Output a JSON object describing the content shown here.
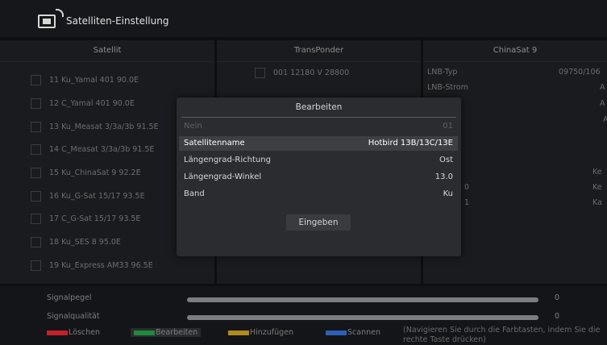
{
  "header": {
    "title": "Satelliten-Einstellung"
  },
  "columns": {
    "satellite": "Satellit",
    "transponder": "TransPonder",
    "info": "ChinaSat 9"
  },
  "satellites": [
    "11  Ku_Yamal 401 90.0E",
    "12  C_Yamal 401 90.0E",
    "13  Ku_Measat 3/3a/3b 91.5E",
    "14  C_Measat 3/3a/3b 91.5E",
    "15  Ku_ChinaSat 9 92.2E",
    "16  Ku_G-Sat 15/17 93.5E",
    "17  C_G-Sat 15/17 93.5E",
    "18  Ku_SES 8 95.0E",
    "19  Ku_Express AM33 96.5E"
  ],
  "transponder": {
    "row": "001   12180  V  28800"
  },
  "info": {
    "lnb_typ_label": "LNB-Typ",
    "lnb_typ_value": "09750/106",
    "lnb_strom_label": "LNB-Strom",
    "lnb_strom_value": "A",
    "partial_values": [
      "A",
      "A",
      "Ke",
      "Ke",
      "Ka",
      "0",
      "1"
    ]
  },
  "dialog": {
    "title": "Bearbeiten",
    "rows": [
      {
        "label": "Nein",
        "value": "01"
      },
      {
        "label": "Satellitenname",
        "value": "Hotbird 13B/13C/13E"
      },
      {
        "label": "Längengrad-Richtung",
        "value": "Ost"
      },
      {
        "label": "Längengrad-Winkel",
        "value": "13.0"
      },
      {
        "label": "Band",
        "value": "Ku"
      }
    ],
    "enter_button": "Eingeben"
  },
  "signal": {
    "level_label": "Signalpegel",
    "level_value": "0",
    "quality_label": "Signalqualität",
    "quality_value": "0"
  },
  "keys": {
    "delete": "Löschen",
    "edit": "Bearbeiten",
    "add": "Hinzufügen",
    "scan": "Scannen",
    "help": "(Navigieren Sie durch die Farbtasten, indem Sie die rechte Taste drücken)"
  },
  "colors": {
    "red": "#c8202a",
    "green": "#1f8a3d",
    "yellow": "#b08a1c",
    "blue": "#2b5fb8"
  }
}
